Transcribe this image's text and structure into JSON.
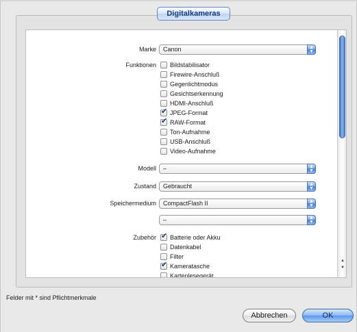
{
  "dialog": {
    "group_title": "Digitalkameras",
    "footnote": "Felder mit * sind Pflichtmerkmale",
    "cancel_label": "Abbrechen",
    "ok_label": "OK"
  },
  "form": {
    "marke": {
      "label": "Marke",
      "value": "Canon"
    },
    "funktionen": {
      "label": "Funktionen",
      "options": [
        {
          "label": "Bildstabilisator",
          "checked": false
        },
        {
          "label": "Firewire-Anschluß",
          "checked": false
        },
        {
          "label": "Gegenlichtmodus",
          "checked": false
        },
        {
          "label": "Gesichtserkennung",
          "checked": false
        },
        {
          "label": "HDMI-Anschluß",
          "checked": false
        },
        {
          "label": "JPEG-Format",
          "checked": true
        },
        {
          "label": "RAW-Format",
          "checked": true
        },
        {
          "label": "Ton-Aufnahme",
          "checked": false
        },
        {
          "label": "USB-Anschluß",
          "checked": false
        },
        {
          "label": "Video-Aufnahme",
          "checked": false
        }
      ]
    },
    "modell": {
      "label": "Modell",
      "value": "–"
    },
    "zustand": {
      "label": "Zustand",
      "value": "Gebraucht"
    },
    "speichermedium": {
      "label": "Speichermedium",
      "value": "CompactFlash II",
      "value2": "–"
    },
    "zubehoer": {
      "label": "Zubehör",
      "options": [
        {
          "label": "Batterie oder Akku",
          "checked": true
        },
        {
          "label": "Datenkabel",
          "checked": false
        },
        {
          "label": "Filter",
          "checked": false
        },
        {
          "label": "Kameratasche",
          "checked": true
        },
        {
          "label": "Kartenlesegerät",
          "checked": false
        }
      ]
    }
  },
  "glyphs": {
    "popup_up": "▲",
    "popup_down": "▼",
    "check": "✔",
    "scroll_up": "▲",
    "scroll_down": "▼"
  },
  "colors": {
    "accent": "#3f7ad7",
    "check": "#163b7a",
    "window_bg": "#e9e9e9"
  }
}
